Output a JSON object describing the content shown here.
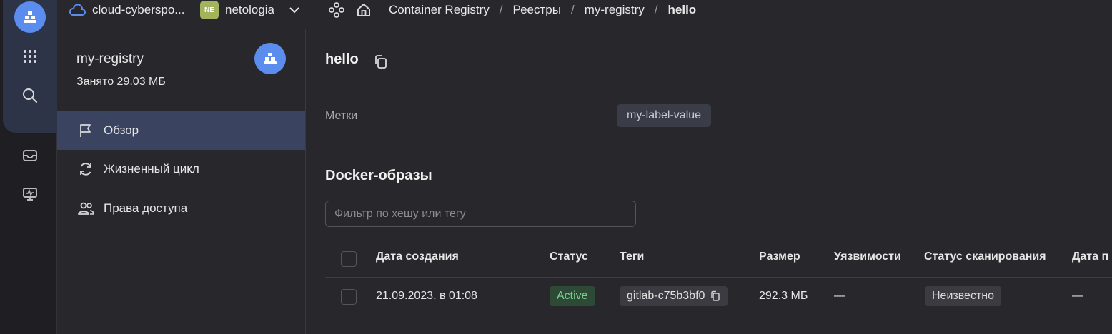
{
  "topbar": {
    "cloud_name": "cloud-cyberspo...",
    "folder_badge": "NE",
    "folder_name": "netologia",
    "breadcrumbs": [
      "Container Registry",
      "Реестры",
      "my-registry",
      "hello"
    ],
    "separator": "/"
  },
  "sidebar": {
    "title": "my-registry",
    "subtitle": "Занято 29.03 МБ",
    "items": [
      {
        "label": "Обзор",
        "icon": "flag-icon",
        "active": true
      },
      {
        "label": "Жизненный цикл",
        "icon": "refresh-icon",
        "active": false
      },
      {
        "label": "Права доступа",
        "icon": "users-icon",
        "active": false
      }
    ]
  },
  "main": {
    "title": "hello",
    "labels_key": "Метки",
    "label_chip": "my-label-value",
    "section_title": "Docker-образы",
    "filter_placeholder": "Фильтр по хешу или тегу",
    "table": {
      "headers": [
        "Дата создания",
        "Статус",
        "Теги",
        "Размер",
        "Уязвимости",
        "Статус сканирования",
        "Дата п"
      ],
      "rows": [
        {
          "created": "21.09.2023, в 01:08",
          "status": "Active",
          "tag": "gitlab-c75b3bf0",
          "size": "292.3 МБ",
          "vulns": "—",
          "scan_status": "Неизвестно",
          "date_last": "—"
        }
      ]
    }
  },
  "colors": {
    "accent": "#5b8def",
    "active_status": "#7ed08f",
    "background": "#28272c"
  }
}
